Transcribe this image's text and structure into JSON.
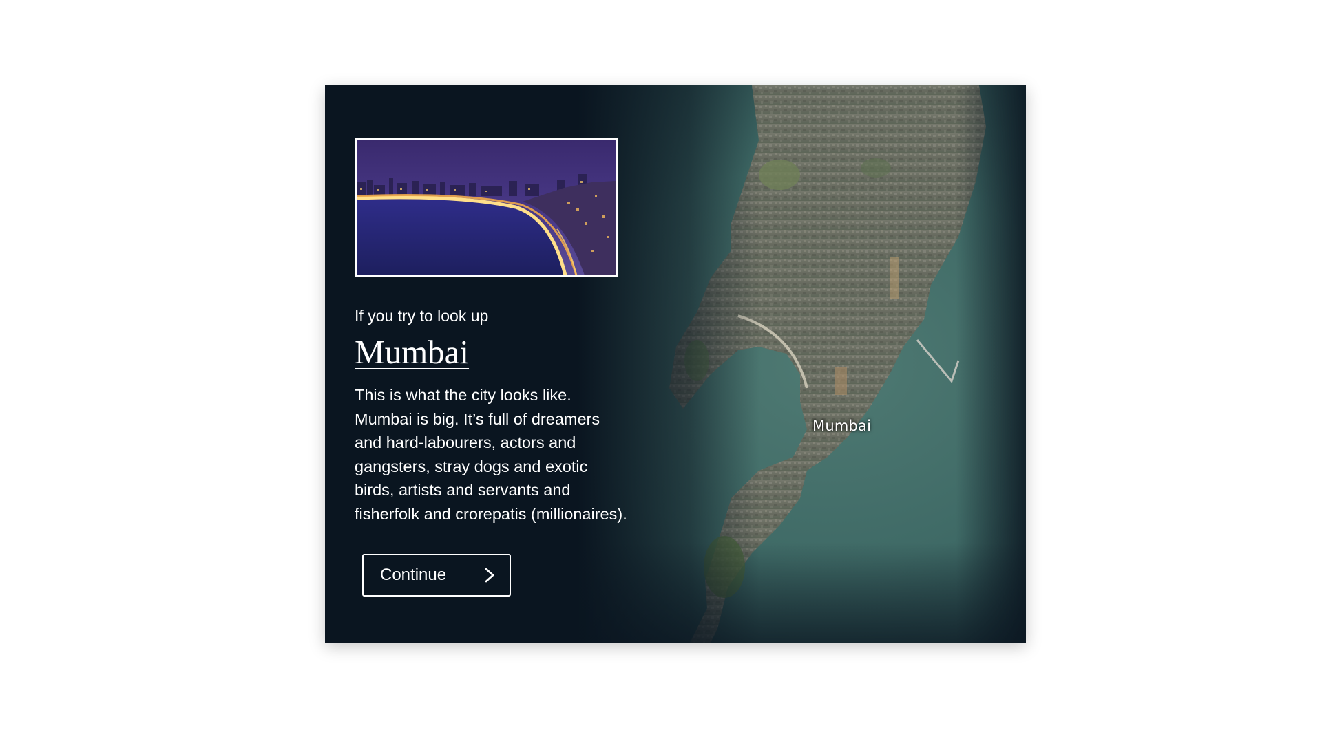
{
  "card": {
    "eyebrow": "If you try to look up",
    "place_name": "Mumbai",
    "body_lines": [
      "This is what the city looks like.",
      "Mumbai is big. It’s full of dreamers",
      "and hard-labourers, actors and",
      "gangsters, stray dogs and exotic",
      "birds, artists and servants and",
      "fisherfolk and crorepatis (millionaires)."
    ],
    "continue_label": "Continue",
    "continue_icon": "chevron-right-icon",
    "thumbnail_alt": "Marine Drive at night",
    "map_label": "Mumbai"
  },
  "colors": {
    "card_background": "#0a1520",
    "sea": "#3f6a66",
    "land": "#6b6f63",
    "text": "#ffffff",
    "page_background": "#ffffff"
  }
}
